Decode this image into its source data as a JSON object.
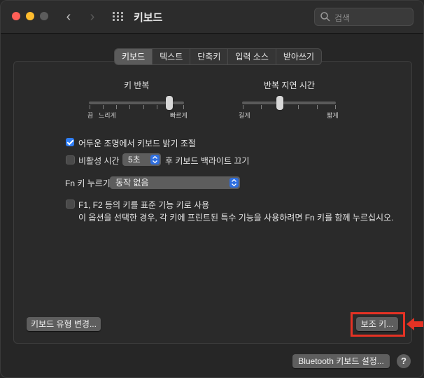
{
  "window": {
    "title": "키보드",
    "search_placeholder": "검색"
  },
  "tabs": [
    {
      "label": "키보드",
      "active": true
    },
    {
      "label": "텍스트",
      "active": false
    },
    {
      "label": "단축키",
      "active": false
    },
    {
      "label": "입력 소스",
      "active": false
    },
    {
      "label": "받아쓰기",
      "active": false
    }
  ],
  "key_repeat": {
    "title": "키 반복",
    "left_label": "끔",
    "left_label2": "느리게",
    "right_label": "빠르게",
    "value_fraction": 0.85
  },
  "repeat_delay": {
    "title": "반복 지연 시간",
    "left_label": "길게",
    "right_label": "짧게",
    "value_fraction": 0.4
  },
  "options": {
    "adjust_backlight": {
      "label": "어두운 조명에서 키보드 밝기 조절",
      "checked": true
    },
    "backlight_off": {
      "label": "비활성 시간",
      "checked": false,
      "value": "5초",
      "suffix": "후 키보드 백라이트 끄기"
    },
    "fn_key": {
      "label": "Fn 키 누르기",
      "value": "동작 없음"
    },
    "fn_standard": {
      "label": "F1, F2 등의 키를 표준 기능 키로 사용",
      "checked": false,
      "note": "이 옵션을 선택한 경우, 각 키에 프린트된 특수 기능을 사용하려면 Fn 키를 함께 누르십시오."
    }
  },
  "buttons": {
    "change_keyboard_type": "키보드 유형 변경...",
    "modifier_keys": "보조 키...",
    "bluetooth_setup": "Bluetooth 키보드 설정...",
    "help": "?"
  },
  "colors": {
    "accent": "#2f7ef6",
    "highlight": "#e53224"
  }
}
